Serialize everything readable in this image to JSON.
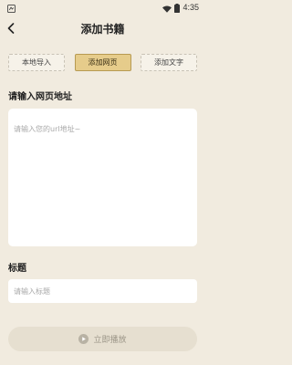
{
  "status_bar": {
    "time": "4:35",
    "icons": [
      "app-logo-icon",
      "wifi-icon",
      "battery-icon"
    ]
  },
  "header": {
    "title": "添加书籍",
    "back_icon": "chevron-left-icon"
  },
  "tabs": [
    {
      "label": "本地导入",
      "active": false
    },
    {
      "label": "添加网页",
      "active": true
    },
    {
      "label": "添加文字",
      "active": false
    }
  ],
  "url_section": {
    "label": "请输入网页地址",
    "placeholder": "请输入您的url地址~"
  },
  "title_section": {
    "label": "标题",
    "placeholder": "请输入标题"
  },
  "play_button": {
    "label": "立即播放",
    "icon": "play-circle-icon"
  },
  "colors": {
    "background": "#f1ebdf",
    "active_tab": "#e6cc8b",
    "button_disabled": "#e6dfd0"
  }
}
